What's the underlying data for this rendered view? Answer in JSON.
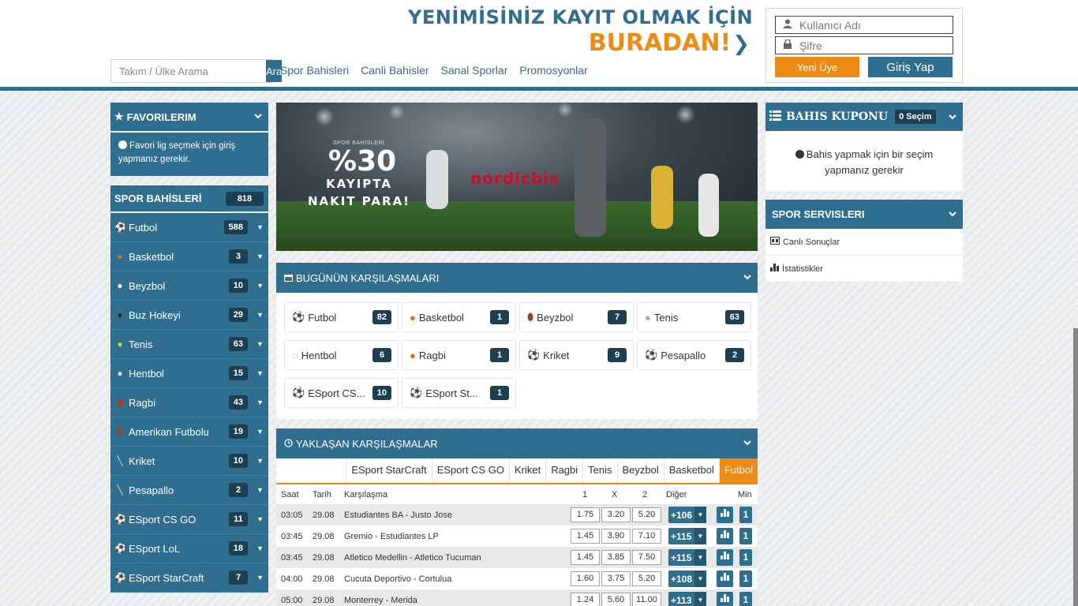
{
  "header": {
    "promo_line1": "YENİMİSİNİZ KAYIT OLMAK İÇİN",
    "promo_line2": "BURADAN!",
    "search_placeholder": "Takım / Ülke Arama",
    "search_button": "Ara",
    "nav": [
      "Spor Bahisleri",
      "Canli Bahisler",
      "Sanal Sporlar",
      "Promosyonlar"
    ],
    "username_placeholder": "Kullanıcı Adı",
    "password_placeholder": "Şifre",
    "register_button": "Yeni Üye",
    "login_button": "Giriş Yap"
  },
  "favorites": {
    "title": "FAVORILERIM",
    "message": "Favori lig seçmek için giriş yapmanız gerekir."
  },
  "sports": {
    "title": "SPOR BAHİSLERİ",
    "total": "818",
    "items": [
      {
        "label": "Futbol",
        "count": "588",
        "icon": "soccer-ball-icon"
      },
      {
        "label": "Basketbol",
        "count": "3",
        "icon": "basketball-icon"
      },
      {
        "label": "Beyzbol",
        "count": "10",
        "icon": "baseball-icon"
      },
      {
        "label": "Buz Hokeyi",
        "count": "29",
        "icon": "hockey-puck-icon"
      },
      {
        "label": "Tenis",
        "count": "63",
        "icon": "tennis-ball-icon"
      },
      {
        "label": "Hentbol",
        "count": "15",
        "icon": "handball-icon"
      },
      {
        "label": "Ragbi",
        "count": "43",
        "icon": "rugby-icon"
      },
      {
        "label": "Amerikan Futbolu",
        "count": "19",
        "icon": "american-football-icon"
      },
      {
        "label": "Kriket",
        "count": "10",
        "icon": "cricket-bat-icon"
      },
      {
        "label": "Pesapallo",
        "count": "2",
        "icon": "pesapallo-bat-icon"
      },
      {
        "label": "ESport CS GO",
        "count": "11",
        "icon": "soccer-ball-icon"
      },
      {
        "label": "ESport LoL",
        "count": "18",
        "icon": "soccer-ball-icon"
      },
      {
        "label": "ESport StarCraft",
        "count": "7",
        "icon": "soccer-ball-icon"
      }
    ]
  },
  "banner": {
    "small_text": "SPOR BAHİSLERİ",
    "percent": "%30",
    "text": "KAYIPTA NAKIT PARA!",
    "logo": "nordicbis"
  },
  "today": {
    "title": "BUGÜNÜN KARŞILAŞMALARI",
    "tiles": [
      {
        "label": "Futbol",
        "count": "82"
      },
      {
        "label": "Basketbol",
        "count": "1"
      },
      {
        "label": "Beyzbol",
        "count": "7"
      },
      {
        "label": "Tenis",
        "count": "63"
      },
      {
        "label": "Hentbol",
        "count": "6"
      },
      {
        "label": "Ragbi",
        "count": "1"
      },
      {
        "label": "Kriket",
        "count": "9"
      },
      {
        "label": "Pesapallo",
        "count": "2"
      },
      {
        "label": "ESport CS...",
        "count": "10"
      },
      {
        "label": "ESport St...",
        "count": "1"
      }
    ]
  },
  "upcoming": {
    "title": "YAKLAŞAN KARŞILAŞMALAR",
    "tabs": [
      "ESport StarCraft",
      "ESport CS GO",
      "Kriket",
      "Ragbi",
      "Tenis",
      "Beyzbol",
      "Basketbol",
      "Futbol"
    ],
    "active_tab": "Futbol",
    "columns": {
      "time": "Saat",
      "date": "Tarih",
      "match": "Karşılaşma",
      "h1": "1",
      "hx": "X",
      "h2": "2",
      "other": "Diğer",
      "min": "Min"
    },
    "matches": [
      {
        "time": "03:05",
        "date": "29.08",
        "match": "Estudiantes BA - Justo Jose",
        "o1": "1.75",
        "ox": "3.20",
        "o2": "5.20",
        "more": "+106",
        "min": "1"
      },
      {
        "time": "03:45",
        "date": "29.08",
        "match": "Gremio - Estudiantes LP",
        "o1": "1.45",
        "ox": "3.90",
        "o2": "7.10",
        "more": "+115",
        "min": "1"
      },
      {
        "time": "03:45",
        "date": "29.08",
        "match": "Atletico Medellin - Atletico Tucuman",
        "o1": "1.45",
        "ox": "3.85",
        "o2": "7.50",
        "more": "+115",
        "min": "1"
      },
      {
        "time": "04:00",
        "date": "29.08",
        "match": "Cucuta Deportivo - Cortulua",
        "o1": "1.60",
        "ox": "3.75",
        "o2": "5.20",
        "more": "+108",
        "min": "1"
      },
      {
        "time": "05:00",
        "date": "29.08",
        "match": "Monterrey - Merida",
        "o1": "1.24",
        "ox": "5.60",
        "o2": "11.00",
        "more": "+113",
        "min": "1"
      }
    ]
  },
  "coupon": {
    "title": "BAHIS KUPONU",
    "badge": "0 Seçim",
    "message": "Bahis yapmak için bir seçim yapmanız gerekir"
  },
  "services": {
    "title": "SPOR SERVISLERI",
    "items": [
      {
        "label": "Canlı Sonuçlar",
        "icon": "scoreboard-icon"
      },
      {
        "label": "İstatistikler",
        "icon": "bar-chart-icon"
      }
    ]
  },
  "colors": {
    "primary": "#2f6e8e",
    "accent": "#ee8a16",
    "badge": "#1d3f52"
  }
}
